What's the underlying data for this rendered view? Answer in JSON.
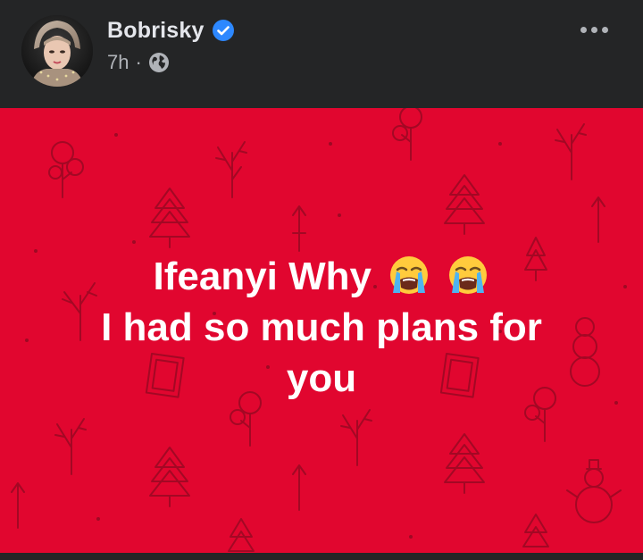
{
  "post": {
    "author_name": "Bobrisky",
    "verified": true,
    "time": "7h",
    "separator": "·",
    "audience_icon": "globe-icon",
    "more_icon": "more-horizontal-icon"
  },
  "status": {
    "background_color": "#e1062f",
    "line1": "Ifeanyi Why",
    "line1_emojis": [
      "loudly-crying-face-emoji",
      "loudly-crying-face-emoji"
    ],
    "line2": "I had so much plans for",
    "line3": "you"
  },
  "colors": {
    "header_bg": "#242526",
    "name_text": "#e4e6eb",
    "meta_text": "#b0b3b8",
    "verified_badge": "#2d88ff"
  }
}
